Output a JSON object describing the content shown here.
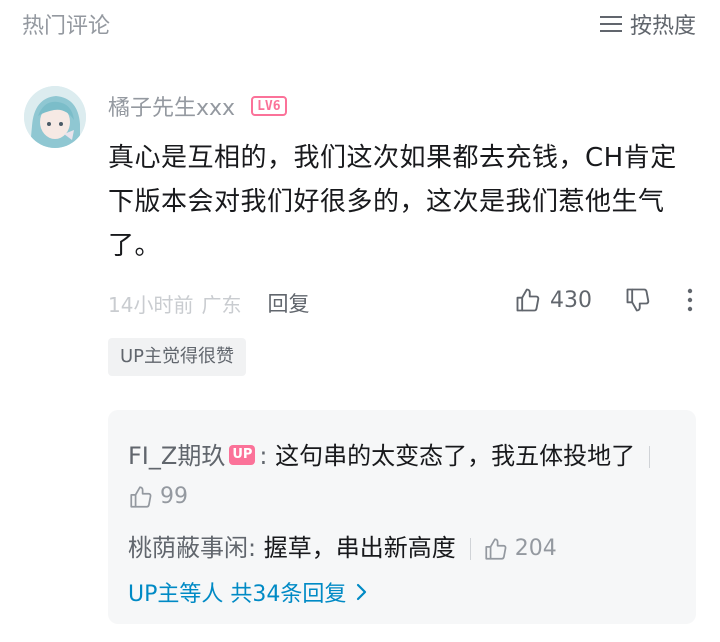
{
  "header": {
    "title": "热门评论",
    "sort_label": "按热度",
    "sort_icon": "list-icon"
  },
  "comment": {
    "username": "橘子先生xxx",
    "level": "LV6",
    "text": "真心是互相的，我们这次如果都去充钱，CH肯定下版本会对我们好很多的，这次是我们惹他生气了。",
    "time": "14小时前",
    "location": "广东",
    "reply_label": "回复",
    "likes": "430",
    "up_liked": "UP主觉得很赞"
  },
  "replies": [
    {
      "name": "FI_Z期玖",
      "badge": "UP",
      "sep": ": ",
      "text": "这句串的太变态了，我五体投地了",
      "likes": "99"
    },
    {
      "name": "桃荫蔽事闲",
      "sep": ": ",
      "text": "握草，串出新高度",
      "likes": "204"
    }
  ],
  "more_replies": "UP主等人 共34条回复",
  "colors": {
    "accent_pink": "#fb7299",
    "link_blue": "#008ac5",
    "muted": "#9499a0"
  }
}
